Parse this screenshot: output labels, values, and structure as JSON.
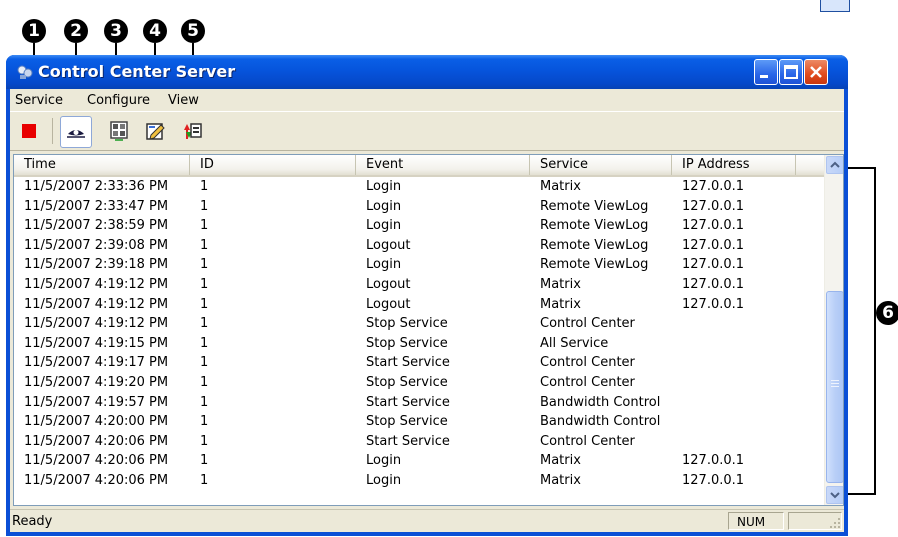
{
  "callouts": [
    "1",
    "2",
    "3",
    "4",
    "5",
    "6"
  ],
  "window": {
    "title": "Control Center Server"
  },
  "menu": [
    {
      "label": "Service"
    },
    {
      "label": "Configure"
    },
    {
      "label": "View"
    }
  ],
  "toolbar": {
    "buttons": [
      {
        "name": "stop-service-button",
        "icon": "stop-square-icon",
        "pressed": false
      },
      {
        "name": "event-log-button",
        "icon": "eye-view-icon",
        "pressed": true
      },
      {
        "name": "monitor-button",
        "icon": "monitor-grid-icon",
        "pressed": false
      },
      {
        "name": "edit-settings-button",
        "icon": "edit-document-icon",
        "pressed": false
      },
      {
        "name": "transfer-button",
        "icon": "up-down-arrows-icon",
        "pressed": false
      }
    ]
  },
  "table": {
    "columns": [
      "Time",
      "ID",
      "Event",
      "Service",
      "IP Address"
    ],
    "rows": [
      [
        "11/5/2007 2:33:36 PM",
        "1",
        "Login",
        "Matrix",
        "127.0.0.1"
      ],
      [
        "11/5/2007 2:33:47 PM",
        "1",
        "Login",
        "Remote ViewLog",
        "127.0.0.1"
      ],
      [
        "11/5/2007 2:38:59 PM",
        "1",
        "Login",
        "Remote ViewLog",
        "127.0.0.1"
      ],
      [
        "11/5/2007 2:39:08 PM",
        "1",
        "Logout",
        "Remote ViewLog",
        "127.0.0.1"
      ],
      [
        "11/5/2007 2:39:18 PM",
        "1",
        "Login",
        "Remote ViewLog",
        "127.0.0.1"
      ],
      [
        "11/5/2007 4:19:12 PM",
        "1",
        "Logout",
        "Matrix",
        "127.0.0.1"
      ],
      [
        "11/5/2007 4:19:12 PM",
        "1",
        "Logout",
        "Matrix",
        "127.0.0.1"
      ],
      [
        "11/5/2007 4:19:12 PM",
        "1",
        "Stop Service",
        "Control Center",
        ""
      ],
      [
        "11/5/2007 4:19:15 PM",
        "1",
        "Stop Service",
        "All Service",
        ""
      ],
      [
        "11/5/2007 4:19:17 PM",
        "1",
        "Start Service",
        "Control Center",
        ""
      ],
      [
        "11/5/2007 4:19:20 PM",
        "1",
        "Stop Service",
        "Control Center",
        ""
      ],
      [
        "11/5/2007 4:19:57 PM",
        "1",
        "Start Service",
        "Bandwidth Control",
        ""
      ],
      [
        "11/5/2007 4:20:00 PM",
        "1",
        "Stop Service",
        "Bandwidth Control",
        ""
      ],
      [
        "11/5/2007 4:20:06 PM",
        "1",
        "Start Service",
        "Control Center",
        ""
      ],
      [
        "11/5/2007 4:20:06 PM",
        "1",
        "Login",
        "Matrix",
        "127.0.0.1"
      ],
      [
        "11/5/2007 4:20:06 PM",
        "1",
        "Login",
        "Matrix",
        "127.0.0.1"
      ]
    ]
  },
  "status": {
    "text": "Ready",
    "num": "NUM"
  },
  "colors": {
    "titlebar": "#0654dc",
    "client": "#ece9d8",
    "stop_red": "#e80000"
  }
}
